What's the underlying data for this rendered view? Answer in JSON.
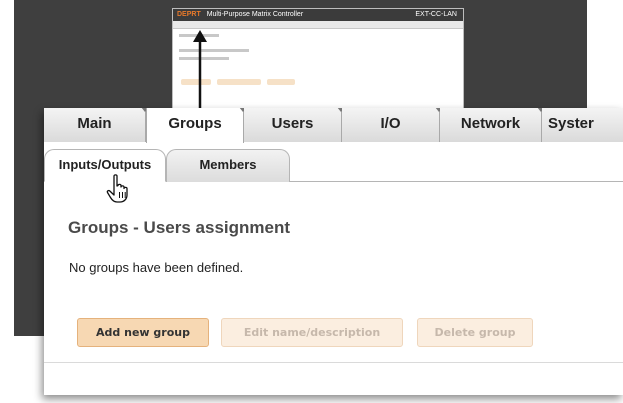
{
  "mini": {
    "logo": "DEPRT",
    "product": "Multi-Purpose Matrix Controller",
    "model": "EXT-CC-LAN"
  },
  "tabs": [
    {
      "label": "Main"
    },
    {
      "label": "Groups"
    },
    {
      "label": "Users"
    },
    {
      "label": "I/O"
    },
    {
      "label": "Network"
    },
    {
      "label": "Syster"
    }
  ],
  "subtabs": [
    {
      "label": "Inputs/Outputs"
    },
    {
      "label": "Members"
    }
  ],
  "content": {
    "title": "Groups - Users assignment",
    "info": "No groups have been defined."
  },
  "buttons": {
    "add": "Add new group",
    "edit": "Edit name/description",
    "delete": "Delete group"
  },
  "colors": {
    "accent": "#f7d8b3",
    "disabled": "#fbeee0",
    "background": "#3f3f3f"
  },
  "icons": {
    "cursor": "hand-pointer-icon",
    "arrow": "arrow-up-icon"
  }
}
